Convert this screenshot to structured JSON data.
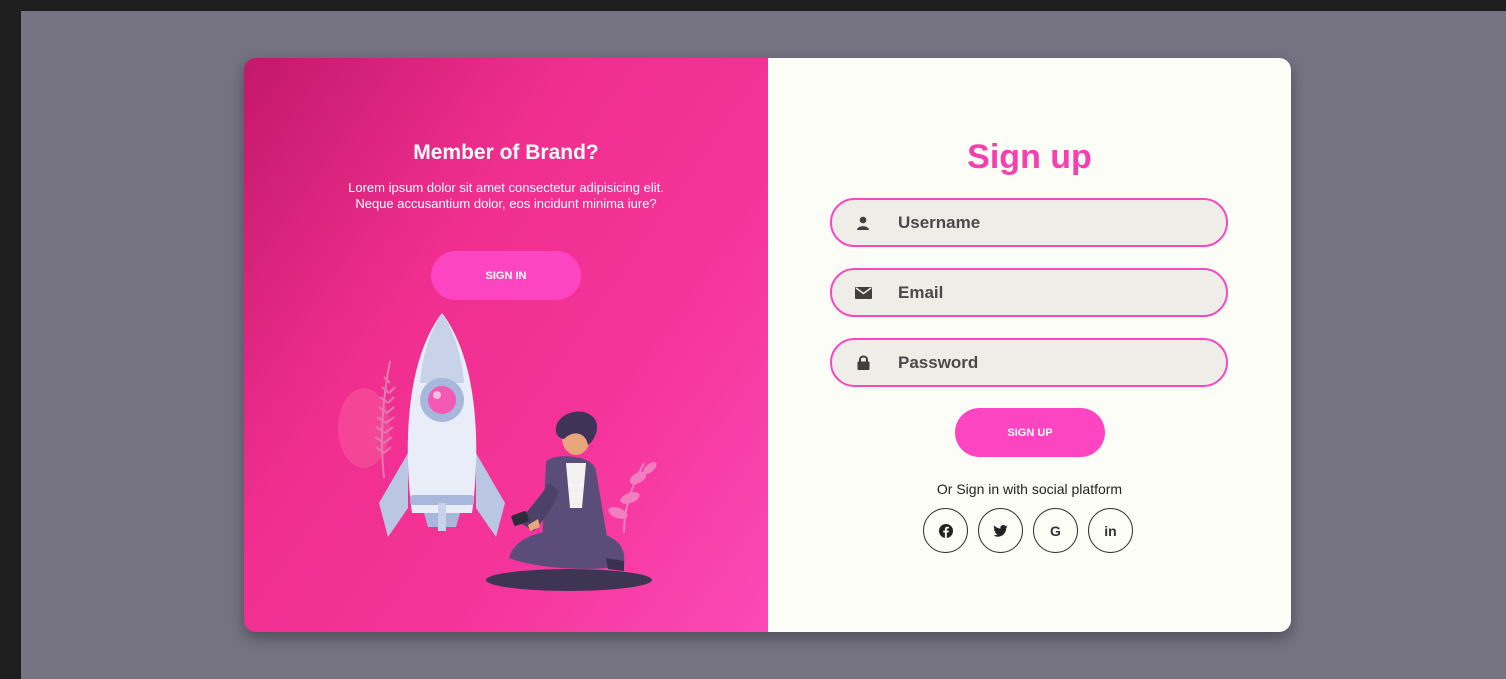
{
  "left": {
    "title": "Member of Brand?",
    "text": "Lorem ipsum dolor sit amet consectetur adipisicing elit. Neque accusantium dolor, eos incidunt minima iure?",
    "signin_label": "SIGN IN"
  },
  "right": {
    "title": "Sign up",
    "fields": {
      "username": {
        "placeholder": "Username",
        "icon": "user-icon"
      },
      "email": {
        "placeholder": "Email",
        "icon": "envelope-icon"
      },
      "password": {
        "placeholder": "Password",
        "icon": "lock-icon"
      }
    },
    "signup_label": "SIGN UP",
    "social_text": "Or Sign in with social platform",
    "social": {
      "facebook": "facebook-icon",
      "twitter": "twitter-icon",
      "google": "G",
      "linkedin": "in"
    }
  },
  "colors": {
    "accent": "#fd45c2",
    "title": "#f83fb0",
    "panel_gradient_start": "#c2186b",
    "panel_gradient_end": "#fb49b6",
    "field_bg": "#efede8",
    "backdrop": "#767483"
  }
}
